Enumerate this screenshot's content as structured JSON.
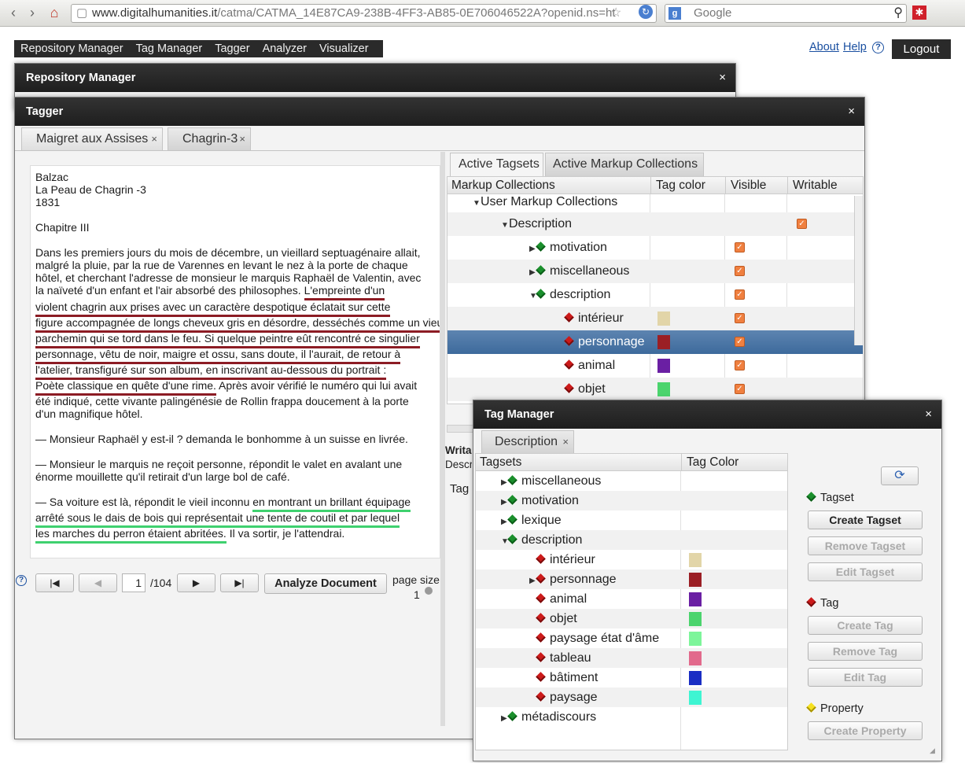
{
  "browser": {
    "url_host": "www.digitalhumanities.it",
    "url_path": "/catma/CATMA_14E87CA9-238B-4FF3-AB85-0E706046522A?openid.ns=ht",
    "search_placeholder": "Google"
  },
  "menu": {
    "items": [
      "Repository Manager",
      "Tag Manager",
      "Tagger",
      "Analyzer",
      "Visualizer"
    ],
    "about": "About",
    "help": "Help",
    "logout": "Logout"
  },
  "repository_window": {
    "title": "Repository Manager"
  },
  "tagger": {
    "title": "Tagger",
    "tabs": [
      "Maigret aux Assises",
      "Chagrin-3"
    ],
    "document": {
      "header": [
        "Balzac",
        "La Peau de Chagrin -3",
        "1831"
      ],
      "chapter": "Chapitre III",
      "p1": [
        "Dans les premiers jours du mois de décembre, un vieillard septuagénaire allait,",
        "malgré la pluie, par la rue de Varennes en levant le nez à la porte de chaque",
        "hôtel, et cherchant l'adresse de monsieur le marquis Raphaël de Valentin, avec",
        "la naïveté d'un enfant et l'air absorbé des philosophes. ",
        "L'empreinte d'un",
        "violent chagrin aux prises avec un caractère despotique éclatait sur cette",
        "figure accompagnée de longs cheveux gris en désordre, desséchés comme un vieux",
        "parchemin qui se tord dans le feu. Si quelque peintre eût rencontré ce singulier",
        " personnage, vêtu de noir, maigre et ossu, sans doute, il l'aurait, de retour à",
        "l'atelier, transfiguré sur son album, en inscrivant au-dessous du portrait :",
        "Poète classique en quête d'une rime.",
        " Après avoir vérifié le numéro qui lui avait",
        " été indiqué, cette vivante palingénésie de Rollin frappa doucement à la porte",
        "d'un magnifique hôtel."
      ],
      "p2": "— Monsieur Raphaël y est-il ? demanda le bonhomme à un suisse en livrée.",
      "p3": [
        "— Monsieur le marquis ne reçoit personne, répondit le valet en avalant une",
        "énorme mouillette qu'il retirait d'un large bol de café."
      ],
      "p4": [
        "— Sa voiture est là, répondit le vieil inconnu ",
        "en montrant un brillant équipage",
        "arrêté sous le dais de bois qui représentait une tente de coutil et par lequel",
        "les marches du perron étaient abritées.",
        " Il va sortir, je l'attendrai."
      ]
    },
    "pager": {
      "page": "1",
      "total": "/104",
      "analyze": "Analyze Document",
      "page_size_label": "page size",
      "page_size_value": "1"
    },
    "right_tabs": [
      "Active Tagsets",
      "Active Markup Collections"
    ],
    "columns": [
      "Markup Collections",
      "Tag color",
      "Visible",
      "Writable"
    ],
    "tree": [
      {
        "label": "User Markup Collections"
      },
      {
        "label": "Description"
      },
      {
        "label": "motivation"
      },
      {
        "label": "miscellaneous"
      },
      {
        "label": "description"
      },
      {
        "label": "intérieur",
        "color": "#e2d5a8"
      },
      {
        "label": "personnage",
        "color": "#9b1f25"
      },
      {
        "label": "animal",
        "color": "#6a1fa3"
      },
      {
        "label": "objet",
        "color": "#4bd46d"
      }
    ],
    "bottom_left": [
      "Writa",
      "Descr",
      "Tag"
    ]
  },
  "tag_manager": {
    "title": "Tag Manager",
    "tab": "Description",
    "columns": [
      "Tagsets",
      "Tag Color"
    ],
    "rows": [
      {
        "label": "miscellaneous"
      },
      {
        "label": "motivation"
      },
      {
        "label": "lexique"
      },
      {
        "label": "description"
      },
      {
        "label": "intérieur",
        "color": "#e2d5a8"
      },
      {
        "label": "personnage",
        "color": "#9b1f25"
      },
      {
        "label": "animal",
        "color": "#6a1fa3"
      },
      {
        "label": "objet",
        "color": "#4bd46d"
      },
      {
        "label": "paysage état d'âme",
        "color": "#7df59a"
      },
      {
        "label": "tableau",
        "color": "#e26a8c"
      },
      {
        "label": "bâtiment",
        "color": "#1a2ec4"
      },
      {
        "label": "paysage",
        "color": "#3ef5d2"
      },
      {
        "label": "métadiscours"
      }
    ],
    "tagset_label": "Tagset",
    "tag_label": "Tag",
    "property_label": "Property",
    "buttons": {
      "create_tagset": "Create Tagset",
      "remove_tagset": "Remove Tagset",
      "edit_tagset": "Edit Tagset",
      "create_tag": "Create Tag",
      "remove_tag": "Remove Tag",
      "edit_tag": "Edit Tag",
      "create_property": "Create Property"
    }
  }
}
